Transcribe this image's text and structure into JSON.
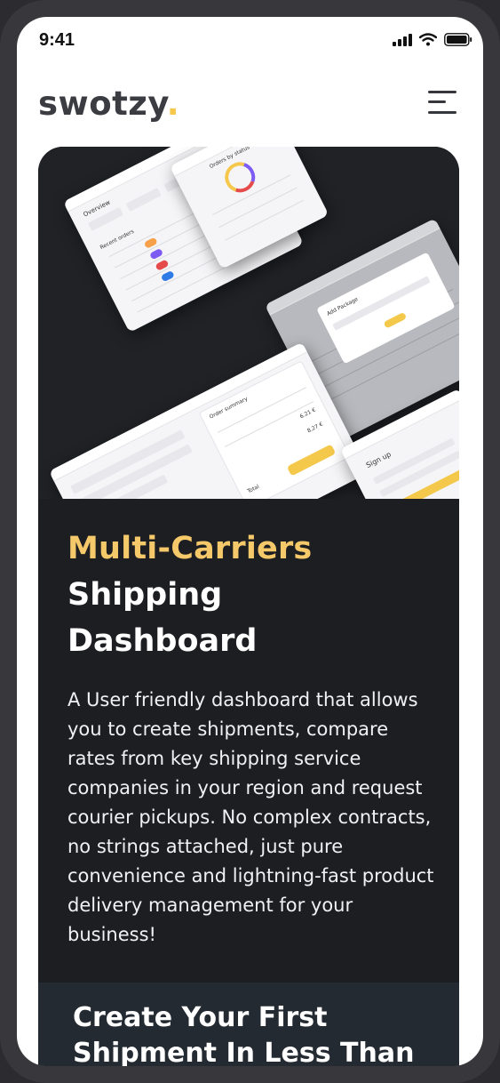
{
  "status_bar": {
    "time": "9:41",
    "icons": [
      "signal-icon",
      "wifi-icon",
      "battery-icon"
    ]
  },
  "header": {
    "logo_text": "swotzy",
    "logo_dot": ".",
    "menu_icon": "hamburger-menu-icon"
  },
  "hero": {
    "title_highlight": "Multi-Carriers",
    "title_line2": "Shipping",
    "title_line3": "Dashboard",
    "description": "A User friendly dashboard that allows you  to create shipments, compare rates from key shipping service companies in your region and request courier pickups. No complex contracts, no strings attached, just pure convenience and lightning-fast product delivery management for your business!",
    "mockup_labels": {
      "overview": "Overview",
      "recent_orders": "Recent orders",
      "orders_by_status": "Orders by status",
      "add_package": "Add Package",
      "sign_up": "Sign up",
      "order_summary": "Order summary",
      "total": "Total",
      "price_a": "6.21 €",
      "price_b": "8.27 €"
    }
  },
  "cta": {
    "title": "Create Your  First Shipment In Less Than"
  },
  "colors": {
    "accent": "#f5c84c",
    "dark_card": "#1d1e22",
    "cta_band": "#242a31"
  }
}
